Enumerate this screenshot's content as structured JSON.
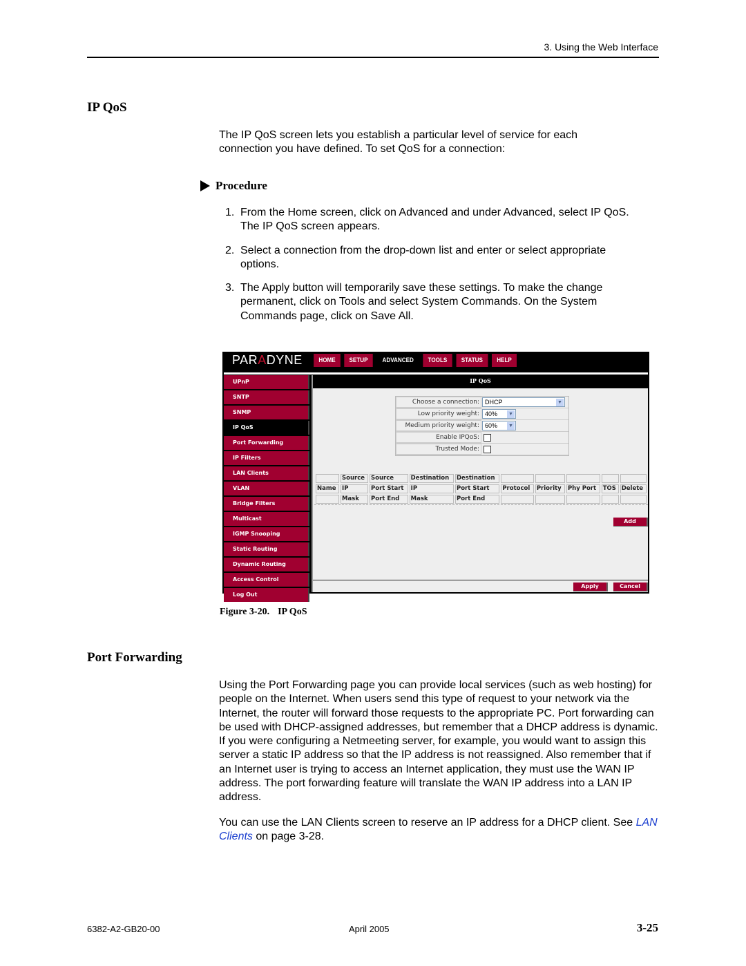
{
  "header": {
    "running_head": "3. Using the Web Interface"
  },
  "ip_qos": {
    "title": "IP QoS",
    "intro": "The IP QoS screen lets you establish a particular level of service for each connection you have defined. To set QoS for a connection:",
    "procedure_label": "Procedure",
    "steps": [
      {
        "num": "1.",
        "text": "From the Home screen, click on Advanced and under Advanced, select IP QoS. The IP QoS screen appears."
      },
      {
        "num": "2.",
        "text": "Select a connection from the drop-down list and enter or select appropriate options."
      },
      {
        "num": "3.",
        "text": "The Apply button will temporarily save these settings. To make the change permanent, click on Tools and select System Commands. On the System Commands page, click on Save All."
      }
    ]
  },
  "router_ui": {
    "logo": {
      "pre": "PAR",
      "a": "A",
      "post": "DYNE"
    },
    "nav_tabs": [
      {
        "label": "HOME",
        "active": false
      },
      {
        "label": "SETUP",
        "active": false
      },
      {
        "label": "ADVANCED",
        "active": true
      },
      {
        "label": "TOOLS",
        "active": false
      },
      {
        "label": "STATUS",
        "active": false
      },
      {
        "label": "HELP",
        "active": false
      }
    ],
    "sidebar": [
      "UPnP",
      "SNTP",
      "SNMP",
      "IP QoS",
      "Port Forwarding",
      "IP Filters",
      "LAN Clients",
      "VLAN",
      "Bridge Filters",
      "Multicast",
      "IGMP Snooping",
      "Static Routing",
      "Dynamic Routing",
      "Access Control",
      "Log Out"
    ],
    "sidebar_active": "IP QoS",
    "panel_title": "IP QoS",
    "form": {
      "connection_label": "Choose a connection:",
      "connection_value": "DHCP",
      "low_label": "Low priority weight:",
      "low_value": "40%",
      "medium_label": "Medium priority weight:",
      "medium_value": "60%",
      "enable_label": "Enable IPQoS:",
      "enable_checked": false,
      "trusted_label": "Trusted Mode:",
      "trusted_checked": false
    },
    "table_headers": [
      [
        "",
        "Source",
        "Source",
        "Destination",
        "Destination",
        "",
        "",
        "",
        "",
        ""
      ],
      [
        "Name",
        "IP",
        "Port Start",
        "IP",
        "Port Start",
        "Protocol",
        "Priority",
        "Phy Port",
        "TOS",
        "Delete"
      ],
      [
        "",
        "Mask",
        "Port End",
        "Mask",
        "Port End",
        "",
        "",
        "",
        "",
        ""
      ]
    ],
    "buttons": {
      "add": "Add",
      "apply": "Apply",
      "cancel": "Cancel"
    }
  },
  "figure_caption": {
    "label": "Figure 3-20.",
    "title": "IP QoS"
  },
  "port_forwarding": {
    "title": "Port Forwarding",
    "para1": "Using the Port Forwarding page you can provide local services (such as web hosting) for people on the Internet. When users send this type of request to your network via the Internet, the router will forward those requests to the appropriate PC. Port forwarding can be used with DHCP-assigned addresses, but remember that a DHCP address is dynamic. If you were configuring a Netmeeting server, for example, you would want to assign this server a static IP address so that the IP address is not reassigned. Also remember that if an Internet user is trying to access an Internet application, they must use the WAN IP address. The port forwarding feature will translate the WAN IP address into a LAN IP address.",
    "para2_pre": "You can use the LAN Clients screen to reserve an IP address for a DHCP client. See ",
    "para2_link": "LAN Clients",
    "para2_post": " on page 3-28."
  },
  "footer": {
    "doc_number": "6382-A2-GB20-00",
    "date": "April 2005",
    "page": "3-25"
  }
}
